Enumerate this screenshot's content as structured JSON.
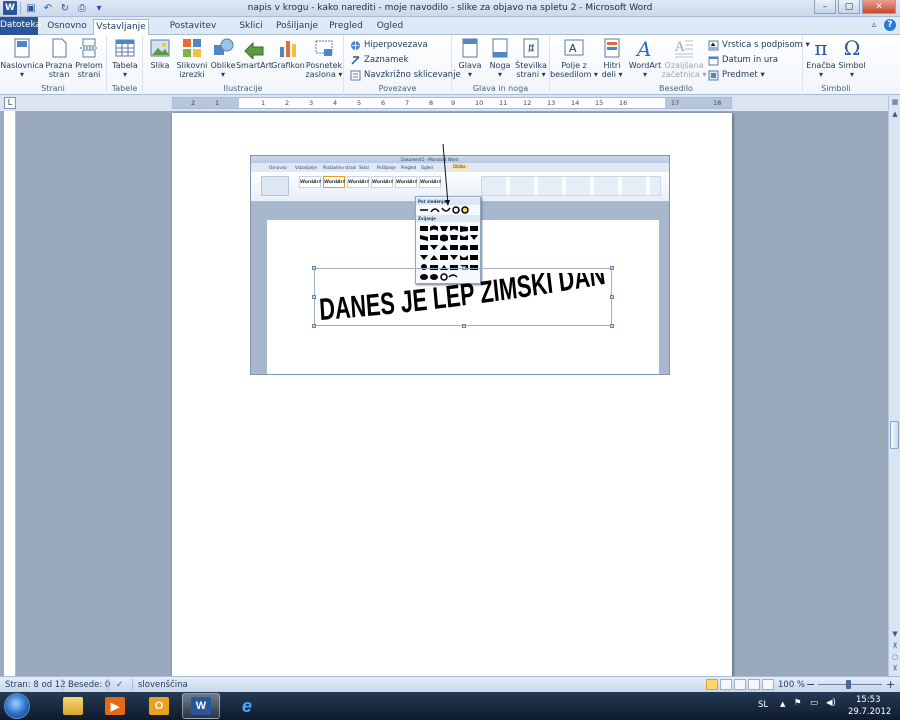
{
  "window": {
    "title": "napis v krogu - kako narediti - moje navodilo - slike za objavo na spletu 2  -  Microsoft Word",
    "controls": {
      "minimize": "–",
      "maximize": "▢",
      "close": "✕"
    }
  },
  "qat": {
    "app_icon": "W",
    "save": "▣",
    "undo": "↶",
    "redo": "↻",
    "print": "⎙",
    "customize": "▾"
  },
  "tabs": [
    {
      "label": "Datoteka"
    },
    {
      "label": "Osnovno"
    },
    {
      "label": "Vstavljanje"
    },
    {
      "label": "Postavitev strani"
    },
    {
      "label": "Sklici"
    },
    {
      "label": "Pošiljanje"
    },
    {
      "label": "Pregled"
    },
    {
      "label": "Ogled"
    }
  ],
  "tab_icons": {
    "minimize_ribbon": "▵",
    "help": "?"
  },
  "ribbon": {
    "groups": [
      {
        "label": "Strani",
        "buttons": [
          "Naslovnica\n▾",
          "Prazna\nstran",
          "Prelom\nstrani"
        ]
      },
      {
        "label": "Tabele",
        "buttons": [
          "Tabela\n▾"
        ]
      },
      {
        "label": "Ilustracije",
        "buttons": [
          "Slika",
          "Slikovni\nizrezki",
          "Oblike\n▾",
          "SmartArt",
          "Grafikon",
          "Posnetek\nzaslona ▾"
        ]
      },
      {
        "label": "Povezave",
        "buttons": [
          "Hiperpovezava",
          "Zaznamek",
          "Navzkrižno sklicevanje"
        ]
      },
      {
        "label": "Glava in noga",
        "buttons": [
          "Glava\n▾",
          "Noga\n▾",
          "Številka\nstrani ▾"
        ]
      },
      {
        "label": "Besedilo",
        "buttons": [
          "Polje z\nbesedilom ▾",
          "Hitri\ndeli ▾",
          "WordArt\n▾",
          "Ozaljšana\nzačetnica ▾",
          "Vrstica s podpisom ▾",
          "Datum in ura",
          "Predmet ▾"
        ]
      },
      {
        "label": "Simboli",
        "buttons": [
          "Enačba\n▾",
          "Simbol\n▾"
        ]
      }
    ]
  },
  "ruler": {
    "corner": "L",
    "numbers": [
      "2",
      "1",
      "1",
      "2",
      "3",
      "4",
      "5",
      "6",
      "7",
      "8",
      "9",
      "10",
      "11",
      "12",
      "13",
      "14",
      "15",
      "16",
      "17",
      "18"
    ]
  },
  "embedded": {
    "title": "Dokument1 - Microsoft Word",
    "tabs": [
      "Osnovno",
      "Vstavljanje",
      "Postavitev strani",
      "Sklici",
      "Pošiljanje",
      "Pregled",
      "Ogled",
      "Oblika"
    ],
    "wordart_samples": [
      "WordArt",
      "WordArt",
      "WordArt",
      "WordArt",
      "WordArt",
      "WordArt"
    ],
    "menu_head_1": "Pot sledenja",
    "menu_head_2": "Zvijanje",
    "wordart_text": "DANES JE LEP ZIMSKI DAN"
  },
  "status": {
    "page": "Stran: 8 od 12",
    "words": "Besede: 0",
    "language": "slovenščina",
    "zoom": "100 %",
    "zoom_minus": "−",
    "zoom_plus": "+"
  },
  "tray": {
    "lang": "SL",
    "time": "15:53",
    "date": "29.7.2012",
    "up_arrow": "▲",
    "flag": "⚑",
    "network": "▭",
    "volume": "◀)"
  },
  "scroll": {
    "up": "▲",
    "down": "▼",
    "prev": "⊼",
    "select": "○",
    "next": "⊻"
  },
  "colors": {
    "accent": "#2a5699",
    "ribbon_text": "#1e395b"
  }
}
